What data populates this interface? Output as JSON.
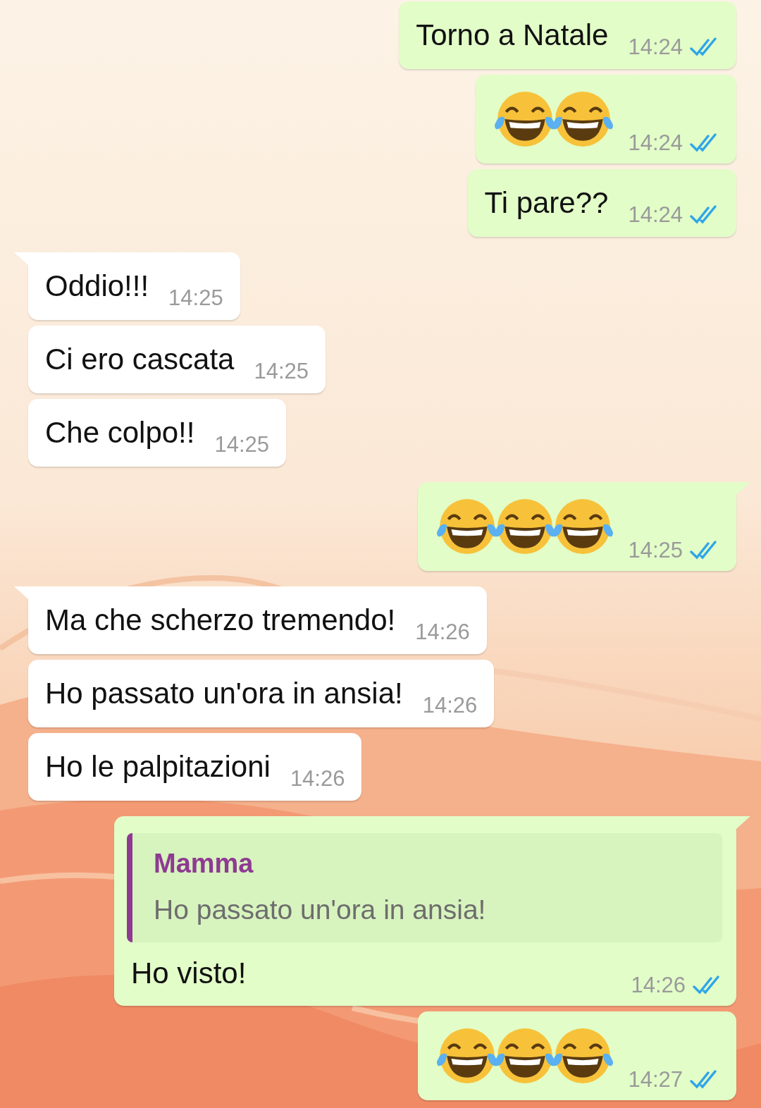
{
  "messages": [
    {
      "outgoing": true,
      "kind": "text",
      "tail": false,
      "text": "Torno a Natale",
      "time": "14:24",
      "read": true
    },
    {
      "outgoing": true,
      "kind": "emoji",
      "tail": false,
      "emojis": [
        {
          "kind": "tears_of_joy"
        },
        {
          "kind": "tears_of_joy"
        }
      ],
      "time": "14:24",
      "read": true
    },
    {
      "outgoing": true,
      "kind": "text",
      "tail": false,
      "text": "Ti pare??",
      "time": "14:24",
      "read": true
    },
    {
      "outgoing": false,
      "kind": "text",
      "tail": true,
      "text": "Oddio!!!",
      "time": "14:25"
    },
    {
      "outgoing": false,
      "kind": "text",
      "tail": false,
      "text": "Ci ero cascata",
      "time": "14:25"
    },
    {
      "outgoing": false,
      "kind": "text",
      "tail": false,
      "text": "Che colpo!!",
      "time": "14:25"
    },
    {
      "outgoing": true,
      "kind": "emoji",
      "tail": true,
      "emojis": [
        {
          "kind": "tears_of_joy"
        },
        {
          "kind": "tears_of_joy"
        },
        {
          "kind": "tears_of_joy"
        }
      ],
      "time": "14:25",
      "read": true
    },
    {
      "outgoing": false,
      "kind": "text",
      "tail": true,
      "text": "Ma che scherzo tremendo!",
      "time": "14:26"
    },
    {
      "outgoing": false,
      "kind": "text",
      "tail": false,
      "text": "Ho passato un'ora in ansia!",
      "time": "14:26"
    },
    {
      "outgoing": false,
      "kind": "text",
      "tail": false,
      "text": "Ho le palpitazioni",
      "time": "14:26"
    },
    {
      "outgoing": true,
      "kind": "reply",
      "tail": true,
      "quote": {
        "author": "Mamma",
        "text": "Ho passato un'ora in ansia!"
      },
      "text": "Ho visto!",
      "time": "14:26",
      "read": true
    },
    {
      "outgoing": true,
      "kind": "emoji",
      "tail": false,
      "emojis": [
        {
          "kind": "tears_of_joy"
        },
        {
          "kind": "tears_of_joy"
        },
        {
          "kind": "tears_of_joy"
        }
      ],
      "time": "14:27",
      "read": true
    }
  ]
}
